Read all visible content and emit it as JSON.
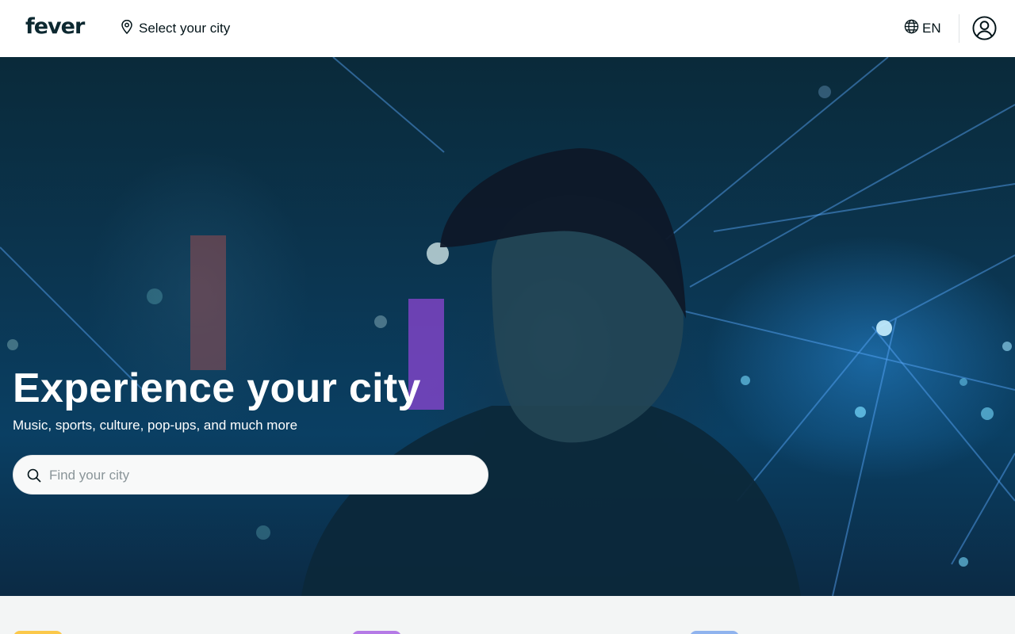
{
  "header": {
    "logo_text": "fever",
    "city_selector_label": "Select your city",
    "language_label": "EN",
    "icons": {
      "location": "map-pin-icon",
      "language": "globe-icon",
      "account": "user-account-icon"
    }
  },
  "hero": {
    "title": "Experience your city",
    "subtitle": "Music, sports, culture, pop-ups, and much more",
    "search": {
      "placeholder": "Find your city",
      "value": "",
      "icon": "search-icon"
    }
  },
  "categories": {
    "tile_colors": [
      "#fbc84a",
      "#b57ae6",
      "#8fb3ee"
    ]
  },
  "colors": {
    "text_primary": "#031419",
    "header_bg": "#ffffff",
    "search_bg": "#f8f9f9",
    "bottom_bg": "#f3f5f5"
  }
}
